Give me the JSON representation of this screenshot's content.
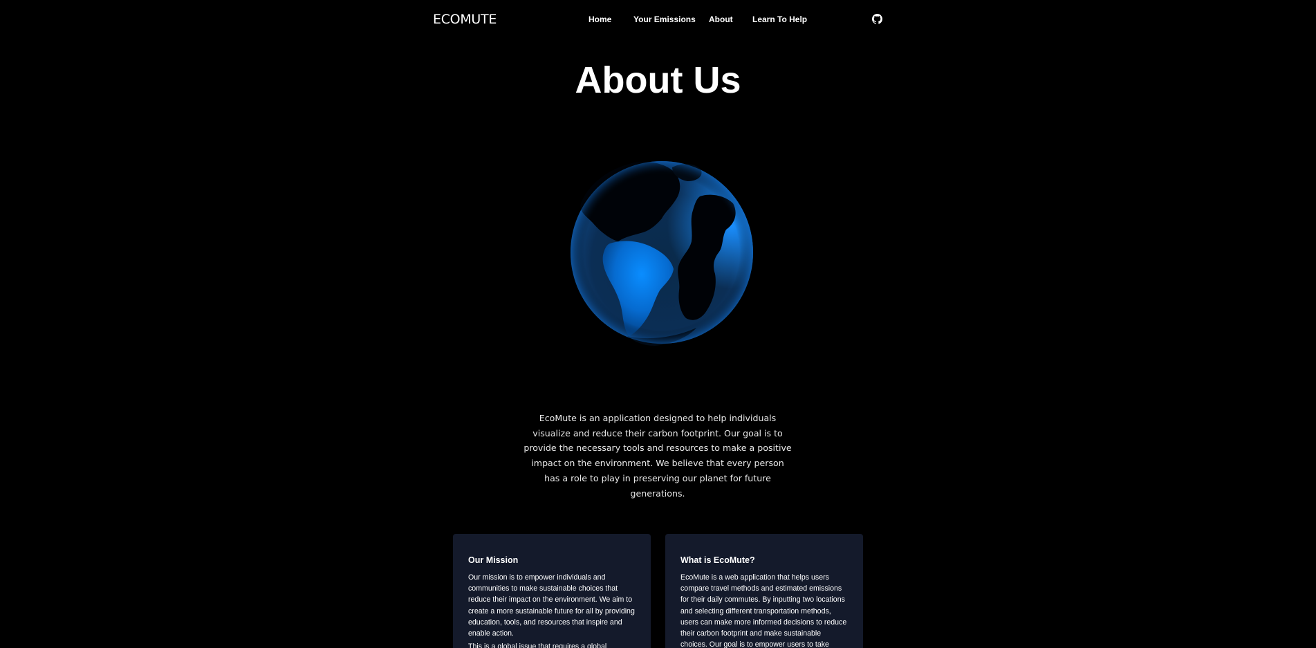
{
  "brand": "ECOMUTE",
  "nav": {
    "items": [
      {
        "label": "Home"
      },
      {
        "label": "Your Emissions"
      },
      {
        "label": "About"
      },
      {
        "label": "Learn To Help"
      }
    ],
    "github_icon": "github-icon"
  },
  "page_title": "About Us",
  "globe_icon": "globe-earth",
  "intro_text": "EcoMute is an application designed to help individuals visualize and reduce their carbon footprint. Our goal is to provide the necessary tools and resources to make a positive impact on the environment. We believe that every person has a role to play in preserving our planet for future generations.",
  "cards": [
    {
      "title": "Our Mission",
      "paragraphs": [
        "Our mission is to empower individuals and communities to make sustainable choices that reduce their impact on the environment. We aim to create a more sustainable future for all by providing education, tools, and resources that inspire and enable action.",
        "This is a global issue that requires a global"
      ]
    },
    {
      "title": "What is EcoMute?",
      "paragraphs": [
        "EcoMute is a web application that helps users compare travel methods and estimated emissions for their daily commutes. By inputting two locations and selecting different transportation methods, users can make more informed decisions to reduce their carbon footprint and make sustainable choices. Our goal is to empower users to take"
      ]
    }
  ],
  "colors": {
    "background": "#000000",
    "card_background": "#141a2b",
    "globe_blue": "#0a84ff"
  }
}
